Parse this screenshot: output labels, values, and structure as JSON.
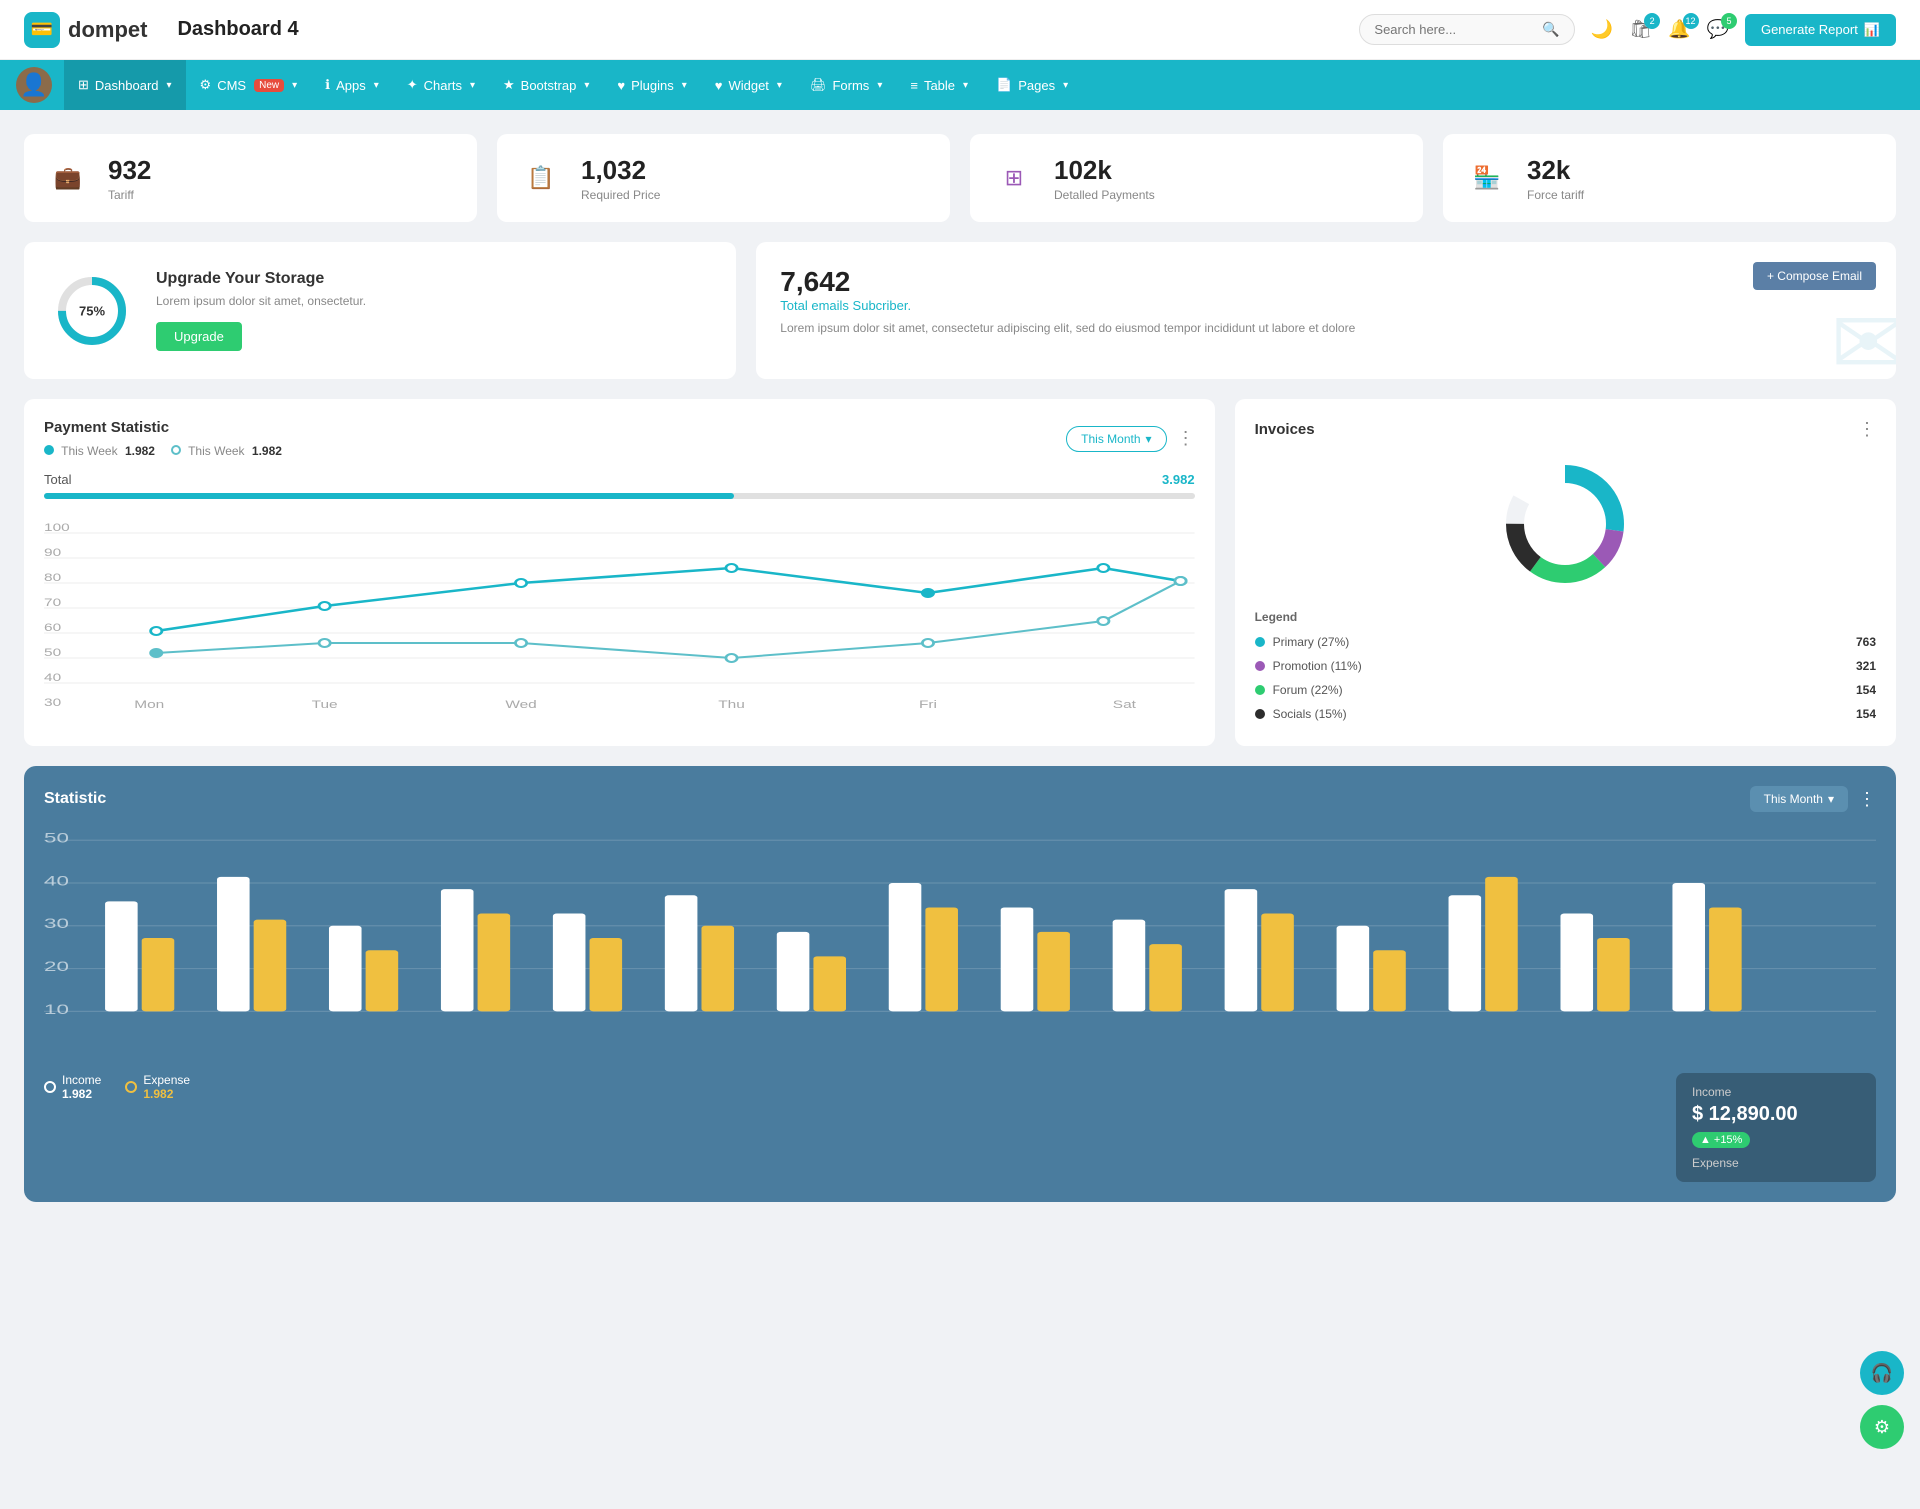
{
  "header": {
    "logo_icon": "💳",
    "logo_text": "dompet",
    "page_title": "Dashboard 4",
    "search_placeholder": "Search here...",
    "search_icon": "🔍",
    "dark_mode_icon": "🌙",
    "cart_icon": "🛍",
    "cart_badge": "2",
    "bell_icon": "🔔",
    "bell_badge": "12",
    "chat_icon": "💬",
    "chat_badge": "5",
    "generate_btn": "Generate Report",
    "generate_icon": "📊"
  },
  "nav": {
    "items": [
      {
        "label": "Dashboard",
        "icon": "⊞",
        "active": true,
        "has_arrow": true
      },
      {
        "label": "CMS",
        "icon": "⚙",
        "has_arrow": true,
        "badge": "New"
      },
      {
        "label": "Apps",
        "icon": "ℹ",
        "has_arrow": true
      },
      {
        "label": "Charts",
        "icon": "✦",
        "has_arrow": true
      },
      {
        "label": "Bootstrap",
        "icon": "★",
        "has_arrow": true
      },
      {
        "label": "Plugins",
        "icon": "♥",
        "has_arrow": true
      },
      {
        "label": "Widget",
        "icon": "♥",
        "has_arrow": true
      },
      {
        "label": "Forms",
        "icon": "🖨",
        "has_arrow": true
      },
      {
        "label": "Table",
        "icon": "≡",
        "has_arrow": true
      },
      {
        "label": "Pages",
        "icon": "📄",
        "has_arrow": true
      }
    ]
  },
  "stats": [
    {
      "num": "932",
      "label": "Tariff",
      "icon": "💼",
      "color": "teal"
    },
    {
      "num": "1,032",
      "label": "Required Price",
      "icon": "📋",
      "color": "red"
    },
    {
      "num": "102k",
      "label": "Detalled Payments",
      "icon": "⊞",
      "color": "purple"
    },
    {
      "num": "32k",
      "label": "Force tariff",
      "icon": "🏪",
      "color": "pink"
    }
  ],
  "upgrade": {
    "percent": "75%",
    "title": "Upgrade Your Storage",
    "desc": "Lorem ipsum dolor sit amet, onsectetur.",
    "btn_label": "Upgrade"
  },
  "email_card": {
    "num": "7,642",
    "sub": "Total emails Subcriber.",
    "desc": "Lorem ipsum dolor sit amet, consectetur adipiscing elit, sed do eiusmod tempor incididunt ut labore et dolore",
    "compose_btn": "+ Compose Email"
  },
  "payment": {
    "title": "Payment Statistic",
    "legend1_label": "This Week",
    "legend1_val": "1.982",
    "legend2_label": "This Week",
    "legend2_val": "1.982",
    "filter_btn": "This Month",
    "total_label": "Total",
    "total_val": "3.982",
    "x_labels": [
      "Mon",
      "Tue",
      "Wed",
      "Thu",
      "Fri",
      "Sat"
    ],
    "y_labels": [
      "100",
      "90",
      "80",
      "70",
      "60",
      "50",
      "40",
      "30"
    ],
    "line1_points": "55,140 155,120 255,100 370,90 490,110 630,80 775,90",
    "line2_points": "55,160 155,150 255,155 370,160 490,155 630,130 775,90"
  },
  "invoices": {
    "title": "Invoices",
    "donut": {
      "segments": [
        {
          "label": "Primary (27%)",
          "color": "#19b6c8",
          "value": 763,
          "pct": 27
        },
        {
          "label": "Promotion (11%)",
          "color": "#9b59b6",
          "value": 321,
          "pct": 11
        },
        {
          "label": "Forum (22%)",
          "color": "#2ecc71",
          "value": 154,
          "pct": 22
        },
        {
          "label": "Socials (15%)",
          "color": "#2c2c2c",
          "value": 154,
          "pct": 15
        }
      ]
    },
    "legend_title": "Legend"
  },
  "statistic": {
    "title": "Statistic",
    "filter_btn": "This Month",
    "income_label": "Income",
    "income_val": "1.982",
    "expense_label": "Expense",
    "expense_val": "1.982",
    "income_box_title": "Income",
    "income_amount": "$ 12,890.00",
    "income_change": "+15%",
    "expense_title": "Expense",
    "bar_labels": [
      "",
      "",
      "",
      "",
      "",
      "",
      "",
      "",
      "",
      "",
      "",
      "",
      "",
      "",
      "",
      "",
      "",
      "",
      "",
      ""
    ],
    "y_labels": [
      "50",
      "40",
      "30",
      "20",
      "10"
    ]
  }
}
